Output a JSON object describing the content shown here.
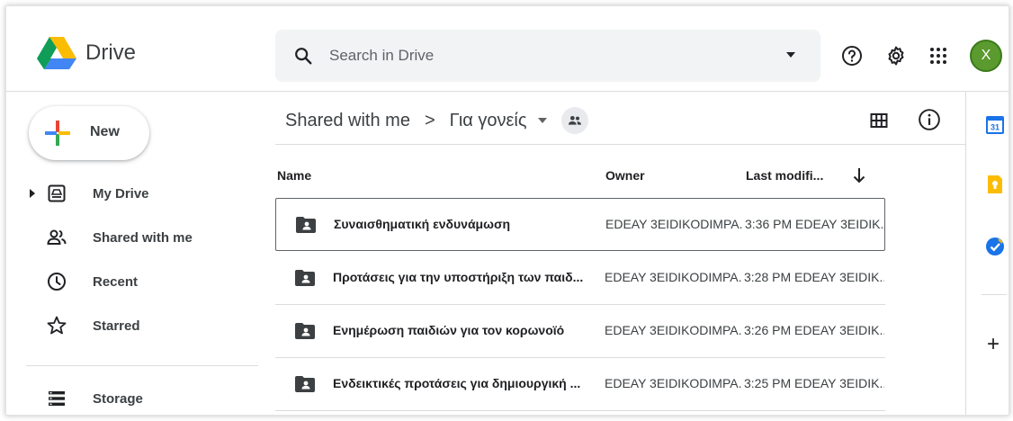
{
  "app": {
    "name": "Drive"
  },
  "search": {
    "placeholder": "Search in Drive"
  },
  "header": {
    "avatar_initial": "X",
    "avatar_color": "#5b9a2e"
  },
  "new_button": {
    "label": "New"
  },
  "sidebar": {
    "items": [
      {
        "label": "My Drive",
        "icon": "my-drive-icon"
      },
      {
        "label": "Shared with me",
        "icon": "shared-people-icon"
      },
      {
        "label": "Recent",
        "icon": "clock-icon"
      },
      {
        "label": "Starred",
        "icon": "star-icon"
      },
      {
        "label": "Storage",
        "icon": "storage-icon"
      }
    ]
  },
  "breadcrumb": {
    "parent": "Shared with me",
    "separator": ">",
    "current": "Για γονείς"
  },
  "columns": {
    "name": "Name",
    "owner": "Owner",
    "modified": "Last modifi..."
  },
  "files": [
    {
      "name": "Συναισθηματική ενδυνάμωση",
      "owner": "EDEAY 3EIDIKODIMPA...",
      "modified": "3:36 PM EDEAY 3EIDIK..."
    },
    {
      "name": "Προτάσεις για την υποστήριξη των παιδ...",
      "owner": "EDEAY 3EIDIKODIMPA...",
      "modified": "3:28 PM EDEAY 3EIDIK..."
    },
    {
      "name": "Ενημέρωση παιδιών για τον κορωνοϊό",
      "owner": "EDEAY 3EIDIKODIMPA...",
      "modified": "3:26 PM EDEAY 3EIDIK..."
    },
    {
      "name": "Ενδεικτικές προτάσεις για δημιουργική ...",
      "owner": "EDEAY 3EIDIKODIMPA...",
      "modified": "3:25 PM EDEAY 3EIDIK..."
    }
  ],
  "right_panel": {
    "calendar_day": "31"
  },
  "colors": {
    "calendar": "#1a73e8",
    "keep": "#fbbc04",
    "tasks": "#1a73e8"
  }
}
